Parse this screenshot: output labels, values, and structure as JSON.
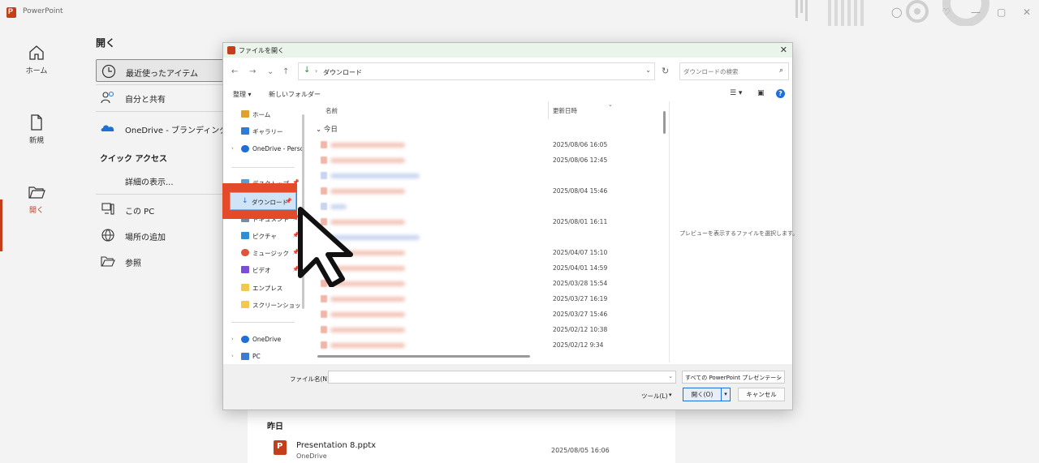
{
  "app": {
    "title": "PowerPoint",
    "window_controls": {
      "minimize": "—",
      "restore": "▢",
      "close": "✕"
    }
  },
  "leftnav": {
    "items": [
      {
        "label": "ホーム",
        "icon": "home-icon"
      },
      {
        "label": "新規",
        "icon": "new-file-icon"
      },
      {
        "label": "開く",
        "icon": "open-folder-icon",
        "active": true
      }
    ],
    "accent": "#c43e1c"
  },
  "open_pane": {
    "heading": "開く",
    "locations": [
      {
        "label": "最近使ったアイテム",
        "icon": "clock-icon",
        "selected": true
      },
      {
        "label": "自分と共有",
        "icon": "shared-people-icon"
      },
      {
        "label": "OneDrive - ブランディング…",
        "icon": "onedrive-cloud-icon"
      }
    ],
    "quick_access_title": "クイック アクセス",
    "show_more": "詳細の表示...",
    "other_locations": [
      {
        "label": "この PC",
        "icon": "pc-icon"
      },
      {
        "label": "場所の追加",
        "icon": "globe-icon"
      },
      {
        "label": "参照",
        "icon": "folder-browse-icon"
      }
    ],
    "background_list": {
      "group": "昨日",
      "file_name": "Presentation 8.pptx",
      "file_location": "OneDrive",
      "file_date": "2025/08/05 16:06"
    }
  },
  "dialog": {
    "title": "ファイルを開く",
    "close": "✕",
    "address": {
      "path": "ダウンロード",
      "separator": "›"
    },
    "search_placeholder": "ダウンロードの検索",
    "toolbar": {
      "organize": "整理 ▾",
      "new_folder": "新しいフォルダー"
    },
    "nav_pane": [
      {
        "label": "ホーム",
        "icon": "home-icon",
        "color": "#e0a030"
      },
      {
        "label": "ギャラリー",
        "icon": "gallery-icon",
        "color": "#2f7cd6"
      },
      {
        "label": "OneDrive - Perso",
        "icon": "onedrive-cloud-icon",
        "color": "#1e6fd9",
        "expandable": true
      },
      {
        "label": "デスクトップ",
        "icon": "desktop-icon",
        "color": "#4aa3df",
        "pinned": true
      },
      {
        "label": "ダウンロード",
        "icon": "download-icon",
        "color": "#1e6fd9",
        "pinned": true,
        "selected": true
      },
      {
        "label": "ドキュメント",
        "icon": "documents-icon",
        "color": "#7c8aa0",
        "pinned": true
      },
      {
        "label": "ピクチャ",
        "icon": "pictures-icon",
        "color": "#2f8fd6",
        "pinned": true
      },
      {
        "label": "ミュージック",
        "icon": "music-icon",
        "color": "#e0533a",
        "pinned": true
      },
      {
        "label": "ビデオ",
        "icon": "video-icon",
        "color": "#7a4fd6",
        "pinned": true
      },
      {
        "label": "エンプレス",
        "icon": "folder-icon",
        "color": "#f2c94c"
      },
      {
        "label": "スクリーンショット",
        "icon": "folder-icon",
        "color": "#f2c94c"
      },
      {
        "label": "OneDrive",
        "icon": "onedrive-cloud-icon",
        "color": "#1e6fd9",
        "expandable": true
      },
      {
        "label": "PC",
        "icon": "pc-icon",
        "color": "#3a7bd5",
        "expandable": true
      }
    ],
    "columns": {
      "name": "名前",
      "date": "更新日時"
    },
    "group_today": "今日",
    "files": [
      {
        "date": "2025/08/06 16:05",
        "kind": "pptx"
      },
      {
        "date": "2025/08/06 12:45",
        "kind": "pptx"
      },
      {
        "date": "",
        "kind": "link"
      },
      {
        "date": "2025/08/04 15:46",
        "kind": "pptx"
      },
      {
        "date": "",
        "kind": "link"
      },
      {
        "date": "2025/08/01 16:11",
        "kind": "pptx"
      },
      {
        "date": "",
        "kind": "link"
      },
      {
        "date": "2025/04/07 15:10",
        "kind": "pptx"
      },
      {
        "date": "2025/04/01 14:59",
        "kind": "pptx"
      },
      {
        "date": "2025/03/28 15:54",
        "kind": "pptx"
      },
      {
        "date": "2025/03/27 16:19",
        "kind": "pptx"
      },
      {
        "date": "2025/03/27 15:46",
        "kind": "pptx"
      },
      {
        "date": "2025/02/12 10:38",
        "kind": "pptx"
      },
      {
        "date": "2025/02/12 9:34",
        "kind": "pptx"
      }
    ],
    "preview_message": "プレビューを表示するファイルを選択します。",
    "footer": {
      "filename_label": "ファイル名(N):",
      "filename_value": "",
      "filetype": "すべての PowerPoint プレゼンテーシ",
      "tools": "ツール(L)",
      "open": "開く(O)",
      "cancel": "キャンセル"
    }
  },
  "annotation": {
    "highlight_color": "#e34a2a"
  }
}
